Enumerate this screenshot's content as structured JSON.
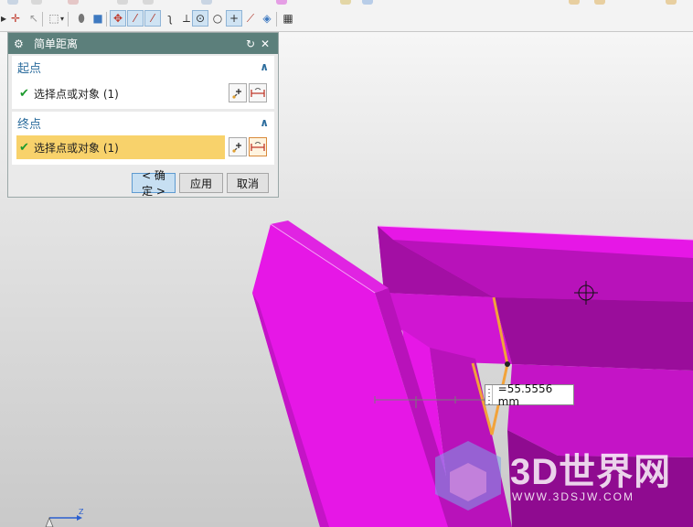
{
  "dialog": {
    "title": "简单距离",
    "start": {
      "title": "起点",
      "select_label": "选择点或对象 (1)"
    },
    "end": {
      "title": "终点",
      "select_label": "选择点或对象 (1)"
    },
    "ok_label": "< 确定 >",
    "apply_label": "应用",
    "cancel_label": "取消"
  },
  "measurement": {
    "value": "=55.5556 mm"
  },
  "watermark": {
    "brand": "3D世界网",
    "url": "WWW.3DSJW.COM"
  },
  "axis": {
    "label": "Z"
  },
  "colors": {
    "part": "#e617e6",
    "part_dark": "#a30fa4",
    "part_mid": "#c414c6",
    "title_bar": "#5c7f7b",
    "highlight": "#f8d26b",
    "accent": "#2a6b9c",
    "edge_highlight": "#f2a33a"
  },
  "toolbar": {
    "active_tools": [
      "snap-to-point",
      "curve-line",
      "tangent-line",
      "center-point",
      "endpoint"
    ]
  }
}
